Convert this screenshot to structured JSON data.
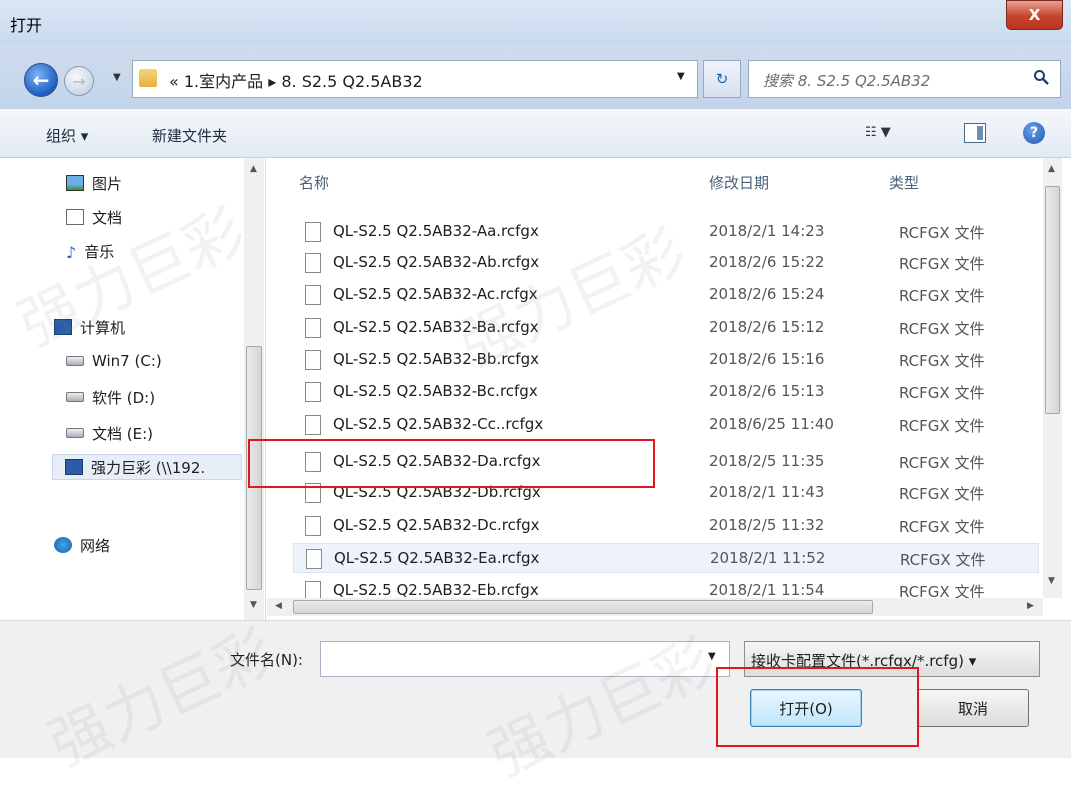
{
  "window": {
    "title": "打开",
    "close_label": "X"
  },
  "navigation": {
    "back_glyph": "←",
    "forward_glyph": "→",
    "address": "«  1.室内产品  ▸  8. S2.5   Q2.5AB32",
    "refresh_glyph": "↻",
    "search_placeholder": "搜索 8. S2.5  Q2.5AB32"
  },
  "toolbar": {
    "organize_label": "组织 ▾",
    "new_folder_label": "新建文件夹",
    "help_glyph": "?"
  },
  "sidebar": {
    "items": [
      {
        "label": "图片",
        "icon": "pictures-icon"
      },
      {
        "label": "文档",
        "icon": "documents-icon"
      },
      {
        "label": "音乐",
        "icon": "music-icon"
      },
      {
        "label": "计算机",
        "icon": "computer-icon"
      },
      {
        "label": "Win7 (C:)",
        "icon": "drive-icon"
      },
      {
        "label": "软件 (D:)",
        "icon": "drive-icon"
      },
      {
        "label": "文档 (E:)",
        "icon": "drive-icon"
      },
      {
        "label": "强力巨彩 (\\\\192.",
        "icon": "network-drive-icon"
      },
      {
        "label": "网络",
        "icon": "network-icon"
      }
    ]
  },
  "file_list": {
    "columns": {
      "name": "名称",
      "date": "修改日期",
      "type": "类型"
    },
    "rows": [
      {
        "name": "QL-S2.5 Q2.5AB32-Aa.rcfgx",
        "date": "2018/2/1 14:23",
        "type": "RCFGX 文件"
      },
      {
        "name": "QL-S2.5 Q2.5AB32-Ab.rcfgx",
        "date": "2018/2/6 15:22",
        "type": "RCFGX 文件"
      },
      {
        "name": "QL-S2.5 Q2.5AB32-Ac.rcfgx",
        "date": "2018/2/6 15:24",
        "type": "RCFGX 文件"
      },
      {
        "name": "QL-S2.5 Q2.5AB32-Ba.rcfgx",
        "date": "2018/2/6 15:12",
        "type": "RCFGX 文件"
      },
      {
        "name": "QL-S2.5 Q2.5AB32-Bb.rcfgx",
        "date": "2018/2/6 15:16",
        "type": "RCFGX 文件"
      },
      {
        "name": "QL-S2.5 Q2.5AB32-Bc.rcfgx",
        "date": "2018/2/6 15:13",
        "type": "RCFGX 文件"
      },
      {
        "name": "QL-S2.5 Q2.5AB32-Cc..rcfgx",
        "date": "2018/6/25 11:40",
        "type": "RCFGX 文件"
      },
      {
        "name": "QL-S2.5 Q2.5AB32-Da.rcfgx",
        "date": "2018/2/5 11:35",
        "type": "RCFGX 文件"
      },
      {
        "name": "QL-S2.5 Q2.5AB32-Db.rcfgx",
        "date": "2018/2/1 11:43",
        "type": "RCFGX 文件"
      },
      {
        "name": "QL-S2.5 Q2.5AB32-Dc.rcfgx",
        "date": "2018/2/5 11:32",
        "type": "RCFGX 文件"
      },
      {
        "name": "QL-S2.5 Q2.5AB32-Ea.rcfgx",
        "date": "2018/2/1 11:52",
        "type": "RCFGX 文件"
      },
      {
        "name": "QL-S2.5 Q2.5AB32-Eb.rcfgx",
        "date": "2018/2/1 11:54",
        "type": "RCFGX 文件"
      }
    ]
  },
  "footer": {
    "filename_label": "文件名(N):",
    "filename_value": "",
    "filter_label": "接收卡配置文件(*.rcfgx/*.rcfg) ▾",
    "open_label": "打开(O)",
    "cancel_label": "取消"
  },
  "watermark": "强力巨彩",
  "colors": {
    "highlight": "#e0171c",
    "accent": "#1f5fc4"
  }
}
